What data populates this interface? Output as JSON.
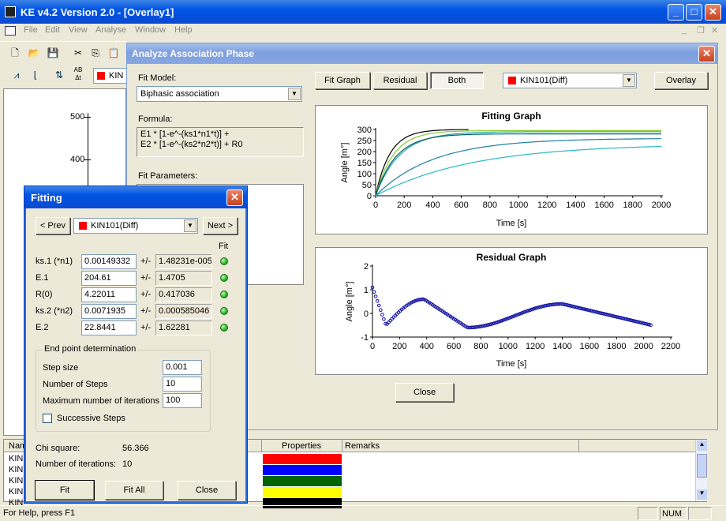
{
  "app": {
    "title": "KE v4.2 Version 2.0 - [Overlay1]",
    "menu": [
      "File",
      "Edit",
      "View",
      "Analyse",
      "Window",
      "Help"
    ],
    "toolbar_selected": "KIN",
    "axis_ticks": [
      "500",
      "400"
    ],
    "status": "For Help, press F1",
    "status_num": "NUM"
  },
  "list": {
    "headers": [
      "Nam",
      "Properties",
      "Remarks"
    ],
    "rows": [
      {
        "name": "KIN",
        "color": "#ff0000"
      },
      {
        "name": "KIN",
        "color": "#0000ff"
      },
      {
        "name": "KIN",
        "color": "#006400"
      },
      {
        "name": "KIN",
        "color": "#ffff00"
      },
      {
        "name": "KIN",
        "color": "#000000"
      }
    ]
  },
  "analyze": {
    "title": "Analyze Association Phase",
    "fit_model_label": "Fit Model:",
    "fit_model": "Biphasic association",
    "formula_label": "Formula:",
    "formula_line1": "E1 * [1-e^-(ks1*n1*t)] +",
    "formula_line2": "E2 * [1-e^-(ks2*n2*t)] + R0",
    "fit_params_label": "Fit Parameters:",
    "tabs": {
      "fit_graph": "Fit Graph",
      "residual": "Residual",
      "both": "Both"
    },
    "curve_select": "KIN101(Diff)",
    "overlay": "Overlay",
    "close": "Close",
    "fitting_graph": {
      "title": "Fitting Graph",
      "ylabel": "Angle [m°]",
      "xlabel": "Time [s]",
      "xticks": [
        "0",
        "200",
        "400",
        "600",
        "800",
        "1000",
        "1200",
        "1400",
        "1600",
        "1800",
        "2000"
      ],
      "yticks": [
        "0",
        "50",
        "100",
        "150",
        "200",
        "250",
        "300"
      ]
    },
    "residual_graph": {
      "title": "Residual Graph",
      "ylabel": "Angle [m°]",
      "xlabel": "Time [s]",
      "xticks": [
        "0",
        "200",
        "400",
        "600",
        "800",
        "1000",
        "1200",
        "1400",
        "1600",
        "1800",
        "2000",
        "2200"
      ],
      "yticks": [
        "-1",
        "0",
        "1",
        "2"
      ]
    }
  },
  "fitting": {
    "title": "Fitting",
    "prev": "< Prev",
    "next": "Next >",
    "curve": "KIN101(Diff)",
    "fit_header": "Fit",
    "params": [
      {
        "name": "ks.1 (*n1)",
        "value": "0.00149332",
        "pm": "+/-",
        "err": "1.48231e-005"
      },
      {
        "name": "E.1",
        "value": "204.61",
        "pm": "+/-",
        "err": "1.4705"
      },
      {
        "name": "R(0)",
        "value": "4.22011",
        "pm": "+/-",
        "err": "0.417036"
      },
      {
        "name": "ks.2 (*n2)",
        "value": "0.0071935",
        "pm": "+/-",
        "err": "0.000585046"
      },
      {
        "name": "E.2",
        "value": "22.8441",
        "pm": "+/-",
        "err": "1.62281"
      }
    ],
    "endpoint": {
      "title": "End point determination",
      "step_size_label": "Step size",
      "step_size": "0.001",
      "steps_label": "Number of Steps",
      "steps": "10",
      "max_iter_label": "Maximum number of iterations",
      "max_iter": "100",
      "successive": "Successive Steps"
    },
    "chi_label": "Chi square:",
    "chi": "56.366",
    "iter_label": "Number of iterations:",
    "iter": "10",
    "fit": "Fit",
    "fit_all": "Fit All",
    "close": "Close"
  },
  "chart_data": [
    {
      "type": "line",
      "title": "Fitting Graph",
      "xlabel": "Time [s]",
      "ylabel": "Angle [m°]",
      "xlim": [
        0,
        2000
      ],
      "ylim": [
        0,
        300
      ],
      "series": [
        {
          "color": "#000000",
          "values_note": "",
          "plateau": 300,
          "k": 0.01,
          "end": 650
        },
        {
          "color": "#88cc33",
          "plateau": 295,
          "k": 0.008,
          "end": 2000
        },
        {
          "color": "#20a0a0",
          "plateau": 290,
          "k": 0.006,
          "end": 2000
        },
        {
          "color": "#006060",
          "plateau": 280,
          "k": 0.007,
          "end": 2000
        },
        {
          "color": "#1c7fa0",
          "plateau": 260,
          "k": 0.0025,
          "end": 2000
        },
        {
          "color": "#2bb8c0",
          "plateau": 235,
          "k": 0.0015,
          "end": 2000
        }
      ]
    },
    {
      "type": "scatter",
      "title": "Residual Graph",
      "xlabel": "Time [s]",
      "ylabel": "Angle [m°]",
      "xlim": [
        0,
        2200
      ],
      "ylim": [
        -1,
        2
      ]
    }
  ]
}
